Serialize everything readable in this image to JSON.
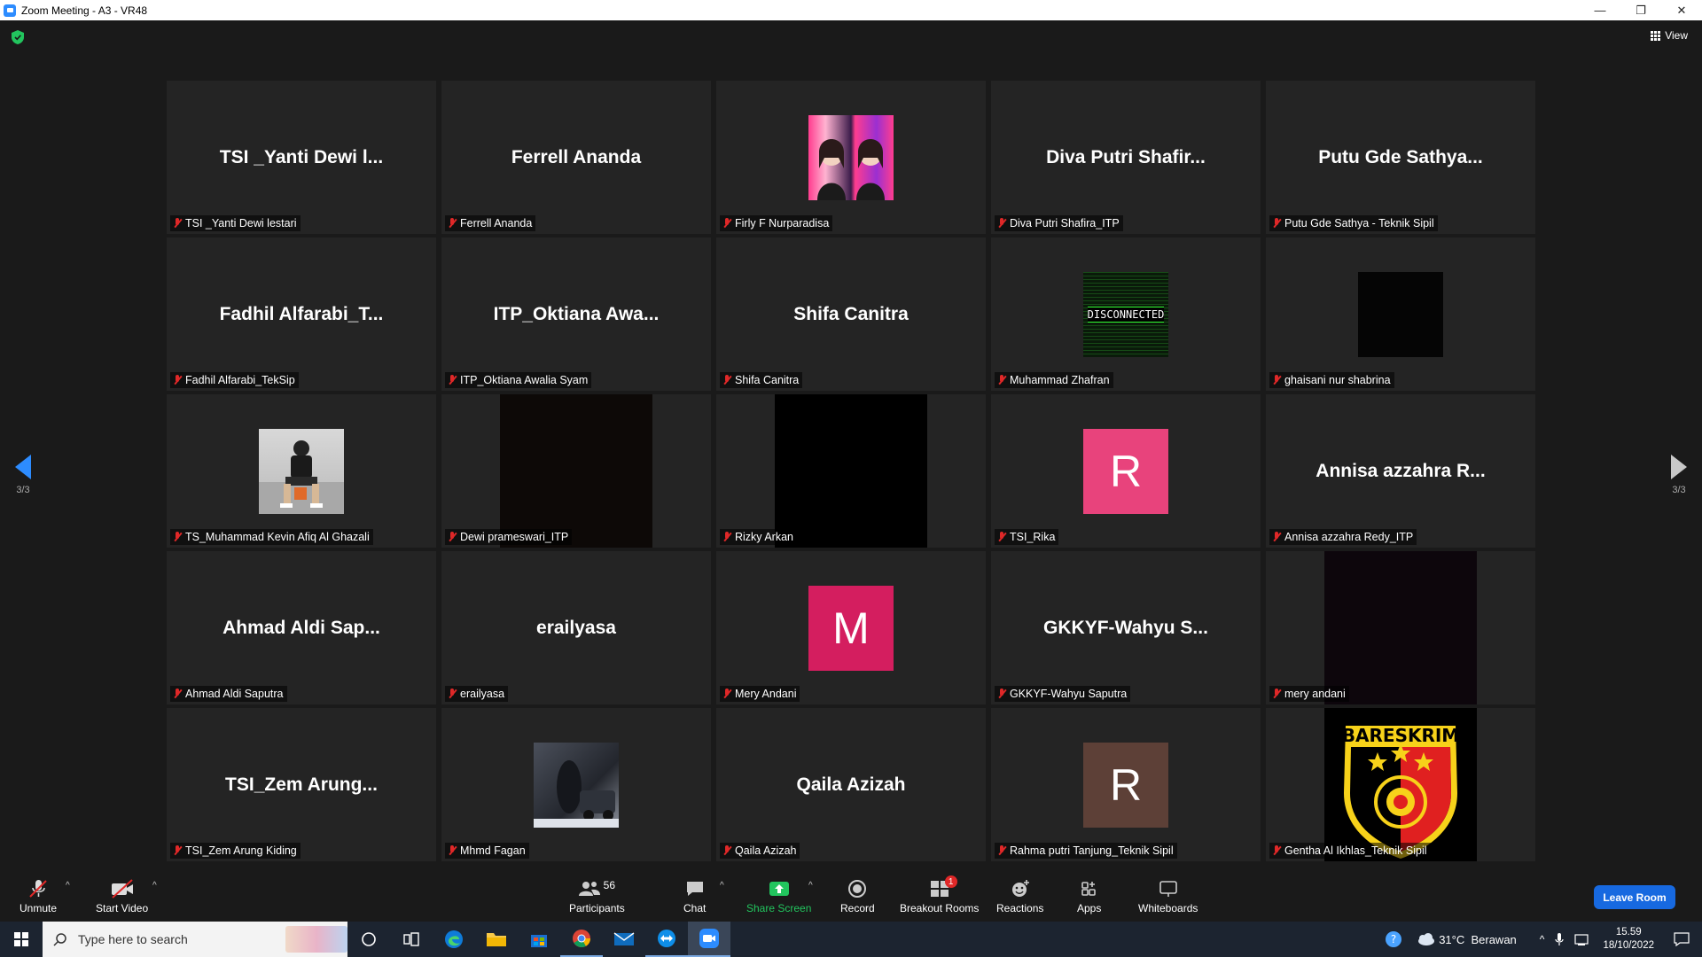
{
  "window": {
    "title": "Zoom Meeting - A3 - VR48",
    "minimize": "—",
    "restore": "❐",
    "close": "✕"
  },
  "meeting": {
    "view_label": "View",
    "page_left": "3/3",
    "page_right": "3/3",
    "tiles": [
      {
        "big": "TSI _Yanti Dewi l...",
        "name": "TSI _Yanti Dewi lestari"
      },
      {
        "big": "Ferrell Ananda",
        "name": "Ferrell Ananda"
      },
      {
        "big": "",
        "name": "Firly F Nurparadisa"
      },
      {
        "big": "Diva Putri Shafir...",
        "name": "Diva Putri Shafira_ITP"
      },
      {
        "big": "Putu Gde Sathya...",
        "name": "Putu Gde Sathya - Teknik Sipil"
      },
      {
        "big": "Fadhil Alfarabi_T...",
        "name": "Fadhil Alfarabi_TekSip"
      },
      {
        "big": "ITP_Oktiana Awa...",
        "name": "ITP_Oktiana Awalia Syam"
      },
      {
        "big": "Shifa Canitra",
        "name": "Shifa Canitra"
      },
      {
        "big": "",
        "name": "Muhammad Zhafran",
        "disconnected": "DISCONNECTED"
      },
      {
        "big": "",
        "name": "ghaisani nur shabrina"
      },
      {
        "big": "",
        "name": "TS_Muhammad Kevin Afiq Al Ghazali"
      },
      {
        "big": "",
        "name": "Dewi prameswari_ITP"
      },
      {
        "big": "",
        "name": "Rizky Arkan"
      },
      {
        "big": "",
        "name": "TSI_Rika",
        "avatar_letter": "R"
      },
      {
        "big": "Annisa azzahra R...",
        "name": "Annisa azzahra Redy_ITP"
      },
      {
        "big": "Ahmad Aldi Sap...",
        "name": "Ahmad Aldi Saputra"
      },
      {
        "big": "erailyasa",
        "name": "erailyasa"
      },
      {
        "big": "",
        "name": "Mery Andani",
        "avatar_letter": "M"
      },
      {
        "big": "GKKYF-Wahyu S...",
        "name": "GKKYF-Wahyu Saputra"
      },
      {
        "big": "",
        "name": "mery andani"
      },
      {
        "big": "TSI_Zem Arung...",
        "name": "TSI_Zem Arung Kiding"
      },
      {
        "big": "",
        "name": "Mhmd Fagan"
      },
      {
        "big": "Qaila Azizah",
        "name": "Qaila Azizah"
      },
      {
        "big": "",
        "name": "Rahma putri Tanjung_Teknik Sipil",
        "avatar_letter": "R"
      },
      {
        "big": "",
        "name": "Gentha Al Ikhlas_Teknik Sipil",
        "logo_text": "BARESKRIM"
      }
    ]
  },
  "toolbar": {
    "unmute": "Unmute",
    "start_video": "Start Video",
    "participants_count": "56",
    "participants": "Participants",
    "chat": "Chat",
    "share_screen": "Share Screen",
    "record": "Record",
    "breakout_rooms": "Breakout Rooms",
    "breakout_badge": "1",
    "reactions": "Reactions",
    "apps": "Apps",
    "whiteboards": "Whiteboards",
    "leave": "Leave Room"
  },
  "taskbar": {
    "search_placeholder": "Type here to search",
    "weather": "31°C  Berawan",
    "time": "15.59",
    "date": "18/10/2022"
  },
  "colors": {
    "accent": "#2d8cff",
    "leave": "#1769e0",
    "share_green": "#22c55e",
    "muted_red": "#e02828"
  }
}
